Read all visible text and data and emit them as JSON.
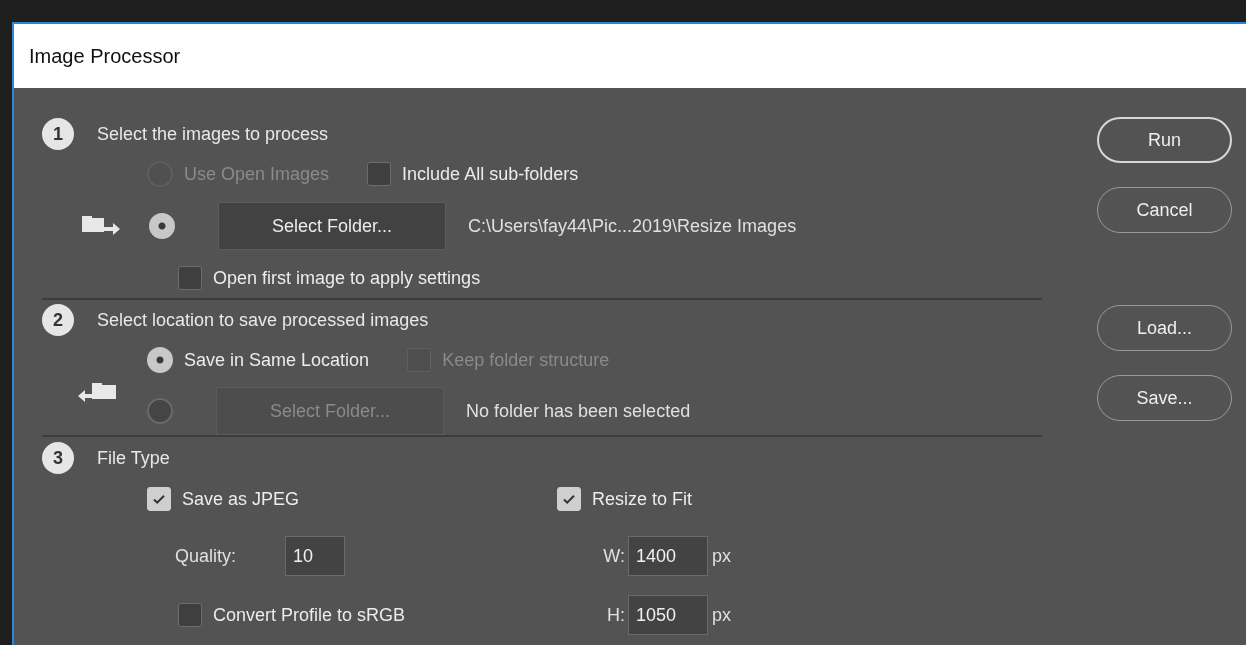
{
  "window": {
    "title": "Image Processor"
  },
  "section_1": {
    "number": "1",
    "title": "Select the images to process",
    "use_open_images": {
      "label": "Use Open Images",
      "selected": false,
      "disabled": true
    },
    "include_subfolders": {
      "label": "Include All sub-folders",
      "checked": false
    },
    "select_folder": {
      "selected": true,
      "button": "Select Folder...",
      "path": "C:\\Users\\fay44\\Pic...2019\\Resize Images"
    },
    "open_first_image": {
      "label": "Open first image to apply settings",
      "checked": false
    }
  },
  "section_2": {
    "number": "2",
    "title": "Select location to save processed images",
    "save_same_location": {
      "label": "Save in Same Location",
      "selected": true
    },
    "keep_folder_structure": {
      "label": "Keep folder structure",
      "checked": false,
      "disabled": true
    },
    "select_folder": {
      "selected": false,
      "disabled": true,
      "button": "Select Folder...",
      "path": "No folder has been selected"
    }
  },
  "section_3": {
    "number": "3",
    "title": "File Type",
    "save_as_jpeg": {
      "label": "Save as JPEG",
      "checked": true
    },
    "quality": {
      "label": "Quality:",
      "value": "10"
    },
    "convert_profile": {
      "label": "Convert Profile to sRGB",
      "checked": false
    },
    "resize_to_fit": {
      "label": "Resize to Fit",
      "checked": true
    },
    "width": {
      "label": "W:",
      "value": "1400",
      "unit": "px"
    },
    "height": {
      "label": "H:",
      "value": "1050",
      "unit": "px"
    }
  },
  "buttons": [
    {
      "label": "Run",
      "default": true
    },
    {
      "label": "Cancel",
      "default": false
    },
    {
      "label": "Load...",
      "default": false
    },
    {
      "label": "Save...",
      "default": false
    }
  ]
}
